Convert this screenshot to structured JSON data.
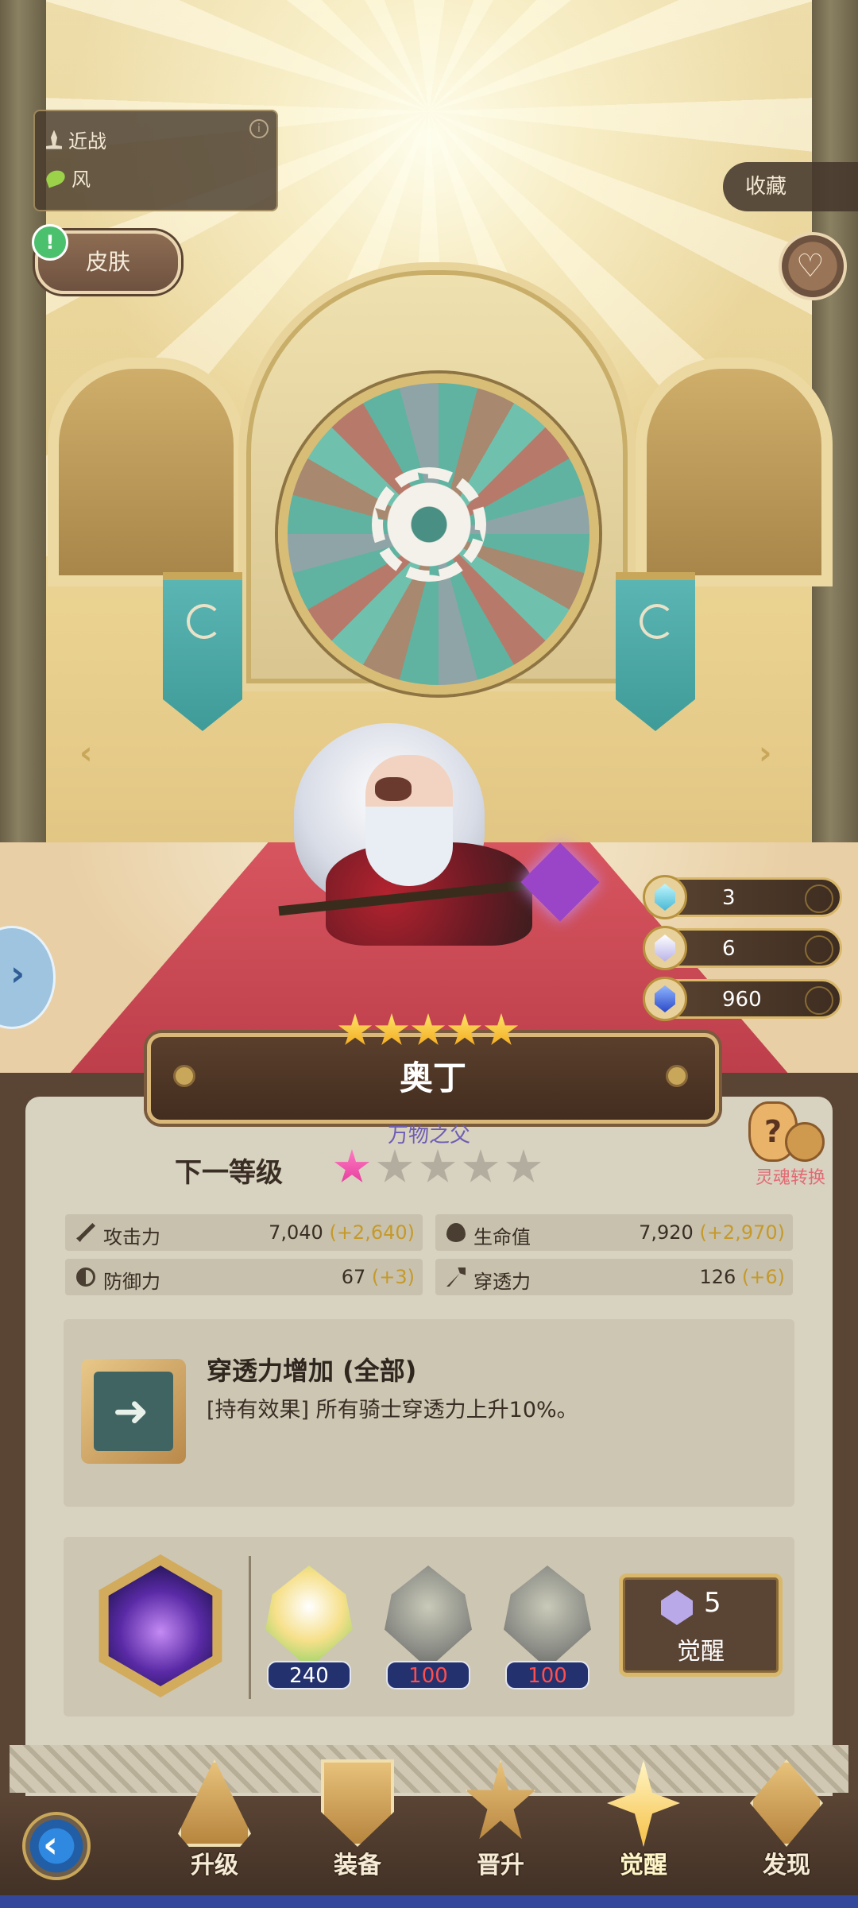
{
  "hero": {
    "role": "近战",
    "element": "风",
    "name": "奥丁",
    "title": "万物之父",
    "stars": 5
  },
  "buttons": {
    "skin": "皮肤",
    "collect": "收藏",
    "soul_convert": "灵魂转换",
    "awaken": "觉醒"
  },
  "resources": [
    {
      "icon": "aqua-crystal-icon",
      "value": "3"
    },
    {
      "icon": "white-crystal-icon",
      "value": "6"
    },
    {
      "icon": "blue-gem-icon",
      "value": "960"
    }
  ],
  "next_level": {
    "label": "下一等级",
    "stars_filled": 1,
    "stars_total": 5
  },
  "stats": [
    {
      "icon": "sword-icon",
      "label": "攻击力",
      "value": "7,040",
      "bonus": "(+2,640)"
    },
    {
      "icon": "heart-icon",
      "label": "生命值",
      "value": "7,920",
      "bonus": "(+2,970)"
    },
    {
      "icon": "shield-icon",
      "label": "防御力",
      "value": "67",
      "bonus": "(+3)"
    },
    {
      "icon": "pierce-icon",
      "label": "穿透力",
      "value": "126",
      "bonus": "(+6)"
    }
  ],
  "effect": {
    "title": "穿透力增加 (全部)",
    "desc": "[持有效果] 所有骑士穿透力上升10%。"
  },
  "awakening": {
    "materials": [
      {
        "name": "hero-shard",
        "count": "240",
        "sufficient": true
      },
      {
        "name": "generic-shard",
        "count": "100",
        "sufficient": false
      },
      {
        "name": "generic-shard",
        "count": "100",
        "sufficient": false
      }
    ],
    "cost": "5"
  },
  "nav": {
    "tabs": [
      "升级",
      "装备",
      "晋升",
      "觉醒",
      "发现"
    ],
    "active": "觉醒"
  },
  "colors": {
    "bonus": "#c59a2a",
    "insufficient": "#ff4e4e",
    "subtitle": "#6d5db4",
    "panel": "#d8d2c0"
  }
}
